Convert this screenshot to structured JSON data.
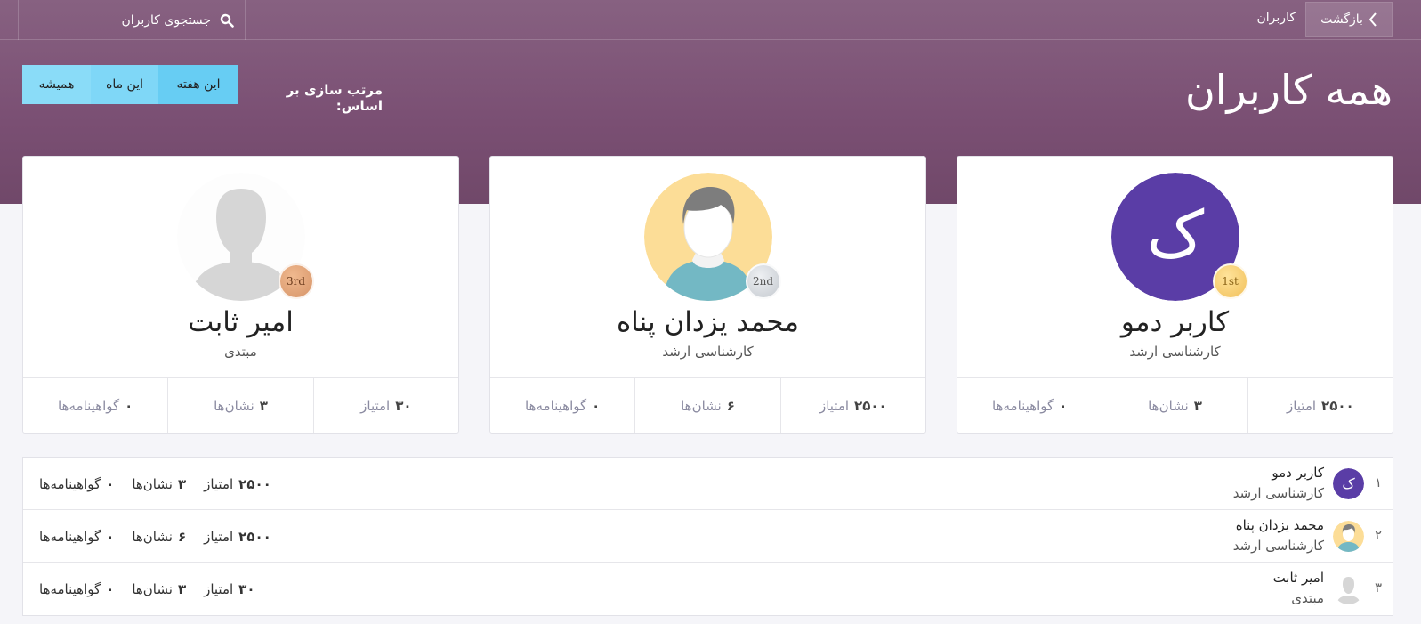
{
  "topbar": {
    "back_label": "بازگشت",
    "breadcrumb": "کاربران",
    "search_placeholder": "جستجوی کاربران"
  },
  "header": {
    "title": "همه کاربران",
    "sort_label": "مرتب سازی بر اساس:",
    "sort_options": [
      "این هفته",
      "این ماه",
      "همیشه"
    ],
    "active_sort": "این هفته"
  },
  "colors": {
    "header_bg": "#7a4f73",
    "sort_button": "#7fd7f7",
    "avatar_demo_bg": "#5a3da6",
    "avatar_man_bg": "#fcdd97"
  },
  "podium": [
    {
      "rank_badge": "1st",
      "avatar_letter": "ک",
      "avatar_icon": "letter-avatar",
      "name": "کاربر دمو",
      "level": "کارشناسی ارشد",
      "points_value": "۲۵۰۰",
      "points_label": "امتیاز",
      "badges_value": "۳",
      "badges_label": "نشان‌ها",
      "certs_value": "۰",
      "certs_label": "گواهینامه‌ها"
    },
    {
      "rank_badge": "2nd",
      "avatar_icon": "man-avatar",
      "name": "محمد یزدان پناه",
      "level": "کارشناسی ارشد",
      "points_value": "۲۵۰۰",
      "points_label": "امتیاز",
      "badges_value": "۶",
      "badges_label": "نشان‌ها",
      "certs_value": "۰",
      "certs_label": "گواهینامه‌ها"
    },
    {
      "rank_badge": "3rd",
      "avatar_icon": "placeholder-avatar",
      "name": "امیر ثابت",
      "level": "مبتدی",
      "points_value": "۳۰",
      "points_label": "امتیاز",
      "badges_value": "۳",
      "badges_label": "نشان‌ها",
      "certs_value": "۰",
      "certs_label": "گواهینامه‌ها"
    }
  ],
  "ranking": [
    {
      "rank": "۱",
      "avatar_letter": "ک",
      "name": "کاربر دمو",
      "level": "کارشناسی ارشد",
      "points_value": "۲۵۰۰",
      "points_label": "امتیاز",
      "badges_value": "۳",
      "badges_label": "نشان‌ها",
      "certs_value": "۰",
      "certs_label": "گواهینامه‌ها"
    },
    {
      "rank": "۲",
      "name": "محمد یزدان پناه",
      "level": "کارشناسی ارشد",
      "points_value": "۲۵۰۰",
      "points_label": "امتیاز",
      "badges_value": "۶",
      "badges_label": "نشان‌ها",
      "certs_value": "۰",
      "certs_label": "گواهینامه‌ها"
    },
    {
      "rank": "۳",
      "name": "امیر ثابت",
      "level": "مبتدی",
      "points_value": "۳۰",
      "points_label": "امتیاز",
      "badges_value": "۳",
      "badges_label": "نشان‌ها",
      "certs_value": "۰",
      "certs_label": "گواهینامه‌ها"
    }
  ]
}
